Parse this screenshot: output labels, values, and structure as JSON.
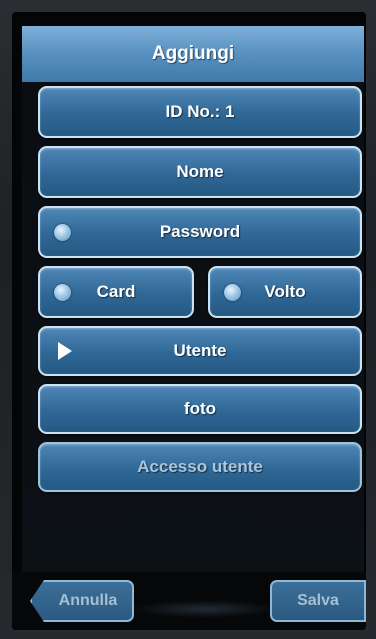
{
  "header": {
    "title": "Aggiungi"
  },
  "menu": {
    "id_no": "ID No.: 1",
    "nome": "Nome",
    "password": "Password",
    "card": "Card",
    "volto": "Volto",
    "utente": "Utente",
    "foto": "foto",
    "accesso_utente": "Accesso utente"
  },
  "footer": {
    "cancel_label": "Annulla",
    "save_label": "Salva"
  },
  "icons": {
    "password": "radio-dot-icon",
    "card": "radio-dot-icon",
    "volto": "radio-dot-icon",
    "utente": "play-arrow-icon"
  },
  "colors": {
    "title_bar": "#5a93c2",
    "button": "#2f6796",
    "button_border": "#c9e3f5",
    "background": "#040608"
  }
}
